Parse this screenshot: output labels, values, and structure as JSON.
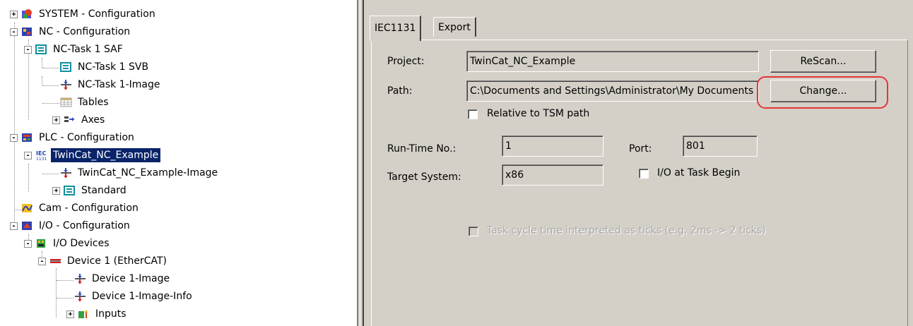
{
  "tree": {
    "items": [
      {
        "label": "SYSTEM - Configuration",
        "icon": "system-config-icon",
        "toggle": "+"
      },
      {
        "label": "NC - Configuration",
        "icon": "nc-config-icon",
        "toggle": "-"
      },
      {
        "label": "NC-Task 1 SAF",
        "icon": "task-icon",
        "toggle": "-"
      },
      {
        "label": "NC-Task 1 SVB",
        "icon": "task-icon",
        "toggle": ""
      },
      {
        "label": "NC-Task 1-Image",
        "icon": "image-icon",
        "toggle": ""
      },
      {
        "label": "Tables",
        "icon": "table-icon",
        "toggle": ""
      },
      {
        "label": "Axes",
        "icon": "axes-icon",
        "toggle": "+"
      },
      {
        "label": "PLC - Configuration",
        "icon": "plc-config-icon",
        "toggle": "-"
      },
      {
        "label": "TwinCat_NC_Example",
        "icon": "iec1131-icon",
        "toggle": "-",
        "selected": true
      },
      {
        "label": "TwinCat_NC_Example-Image",
        "icon": "image-icon",
        "toggle": ""
      },
      {
        "label": "Standard",
        "icon": "task-icon",
        "toggle": "+"
      },
      {
        "label": "Cam - Configuration",
        "icon": "cam-config-icon",
        "toggle": ""
      },
      {
        "label": "I/O - Configuration",
        "icon": "io-config-icon",
        "toggle": "-"
      },
      {
        "label": "I/O Devices",
        "icon": "io-devices-icon",
        "toggle": "-"
      },
      {
        "label": "Device 1 (EtherCAT)",
        "icon": "ethercat-device-icon",
        "toggle": "-"
      },
      {
        "label": "Device 1-Image",
        "icon": "image-icon",
        "toggle": ""
      },
      {
        "label": "Device 1-Image-Info",
        "icon": "image-icon",
        "toggle": ""
      },
      {
        "label": "Inputs",
        "icon": "inputs-icon",
        "toggle": "+"
      }
    ]
  },
  "tabs": [
    {
      "label": "IEC1131",
      "active": true
    },
    {
      "label": "Export",
      "active": false
    }
  ],
  "form": {
    "project_label": "Project:",
    "project_value": "TwinCat_NC_Example",
    "rescan_button": "ReScan...",
    "path_label": "Path:",
    "path_value": "C:\\Documents and Settings\\Administrator\\My Documents",
    "change_button": "Change...",
    "relative_checkbox_label": "Relative to TSM path",
    "relative_checked": false,
    "runtime_label": "Run-Time No.:",
    "runtime_value": "1",
    "port_label": "Port:",
    "port_value": "801",
    "target_label": "Target System:",
    "target_value": "x86",
    "io_task_label": "I/O at Task Begin",
    "io_task_checked": false,
    "ticks_label": "Task cycle time interpreted as ticks (e.g. 2ms -> 2 ticks)",
    "ticks_checked": false
  },
  "colors": {
    "panel_bg": "#d4d0c8",
    "selection_bg": "#0a246a",
    "highlight_ring": "#e53535"
  }
}
